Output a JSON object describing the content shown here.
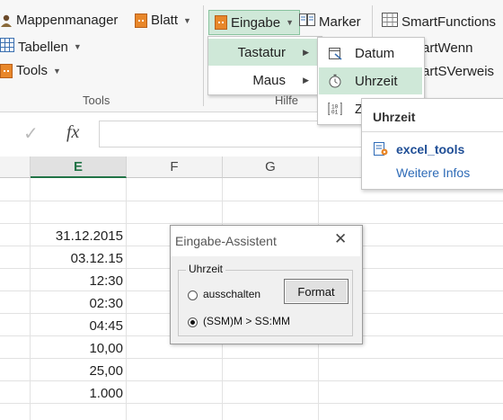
{
  "ribbon": {
    "mappenmanager": "Mappenmanager",
    "blatt": "Blatt",
    "tabellen": "Tabellen",
    "tools": "Tools",
    "eingabe": "Eingabe",
    "marker": "Marker",
    "smartfunctions": "SmartFunctions",
    "smartwenn": "artWenn",
    "smartsverweis": "artSVerweis",
    "group_tools": "Tools",
    "group_hilfe": "Hilfe"
  },
  "eingabe_menu": {
    "items": [
      {
        "label": "Tastatur"
      },
      {
        "label": "Maus"
      }
    ]
  },
  "tastatur_menu": {
    "items": [
      {
        "label": "Datum",
        "icon": "calendar-icon"
      },
      {
        "label": "Uhrzeit",
        "icon": "stopwatch-icon"
      },
      {
        "label": "Z",
        "icon": "binary-icon"
      }
    ]
  },
  "tooltip": {
    "title": "Uhrzeit",
    "addin": "excel_tools",
    "more": "Weitere Infos"
  },
  "formula_bar": {
    "fx": "fx",
    "check": "✓"
  },
  "grid": {
    "columns": [
      "E",
      "F",
      "G"
    ],
    "selected_column": "E",
    "cells": [
      "31.12.2015",
      "03.12.15",
      "12:30",
      "02:30",
      "04:45",
      "10,00",
      "25,00",
      "1.000"
    ]
  },
  "dialog": {
    "title": "Eingabe-Assistent",
    "close": "✕",
    "group_label": "Uhrzeit",
    "option_off": "ausschalten",
    "option_format": "(SSM)M > SS:MM",
    "selected_option": "(SSM)M > SS:MM",
    "format_button": "Format"
  },
  "colors": {
    "accent_green": "#217346",
    "highlight": "#cfe8d8",
    "link_blue": "#2e6bb7"
  }
}
